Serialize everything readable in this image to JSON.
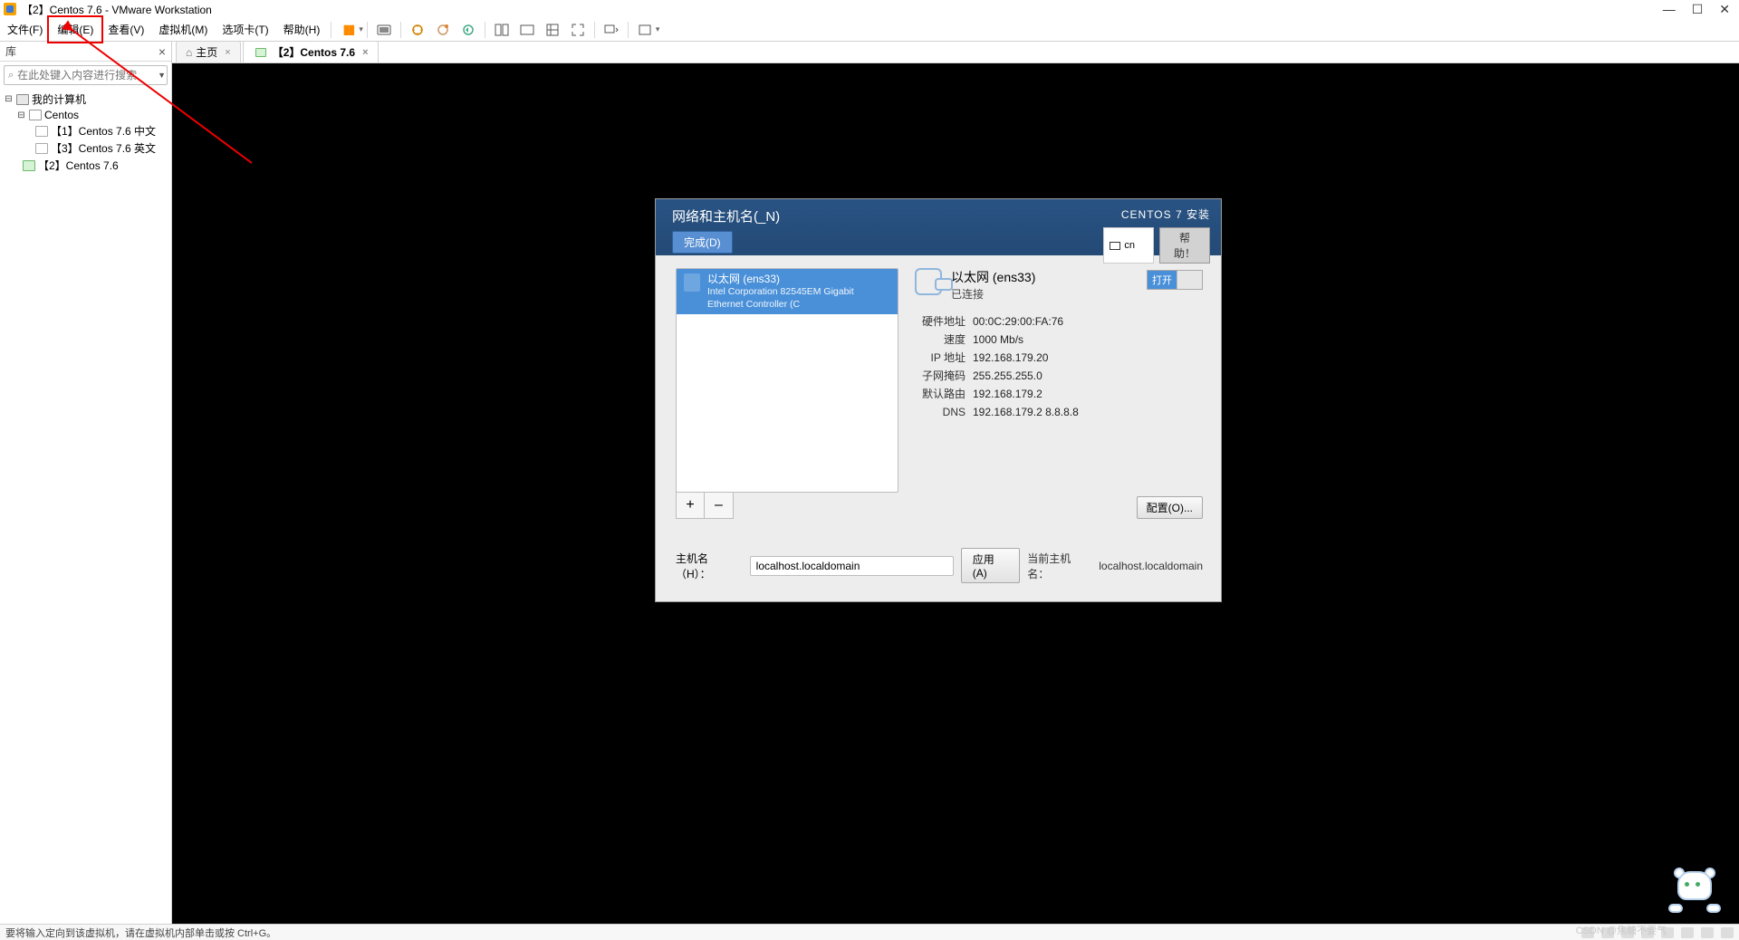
{
  "window": {
    "title": "【2】Centos 7.6 - VMware Workstation"
  },
  "menu": {
    "file": "文件(F)",
    "edit": "编辑(E)",
    "view": "查看(V)",
    "vm": "虚拟机(M)",
    "tabs": "选项卡(T)",
    "help": "帮助(H)"
  },
  "library": {
    "title": "库",
    "search_placeholder": "在此处键入内容进行搜索",
    "root": "我的计算机",
    "folder": "Centos",
    "vm1": "【1】Centos 7.6 中文",
    "vm3": "【3】Centos 7.6 英文",
    "vm2": "【2】Centos 7.6"
  },
  "tabs": {
    "home": "主页",
    "active": "【2】Centos 7.6"
  },
  "centos": {
    "title": "网络和主机名(_N)",
    "done": "完成(D)",
    "install": "CENTOS 7 安装",
    "lang": "cn",
    "help": "帮助！",
    "nic_name": "以太网 (ens33)",
    "nic_sub": "Intel Corporation 82545EM Gigabit Ethernet Controller (C",
    "status": "已连接",
    "toggle_on": "打开",
    "hw_label": "硬件地址",
    "hw": "00:0C:29:00:FA:76",
    "speed_label": "速度",
    "speed": "1000 Mb/s",
    "ip_label": "IP 地址",
    "ip": "192.168.179.20",
    "mask_label": "子网掩码",
    "mask": "255.255.255.0",
    "gw_label": "默认路由",
    "gw": "192.168.179.2",
    "dns_label": "DNS",
    "dns": "192.168.179.2 8.8.8.8",
    "configure": "配置(O)...",
    "host_label": "主机名（H）：",
    "host_value": "localhost.localdomain",
    "apply": "应用(A)",
    "cur_label": "当前主机名：",
    "cur_value": "localhost.localdomain",
    "plus": "+",
    "minus": "–"
  },
  "status": {
    "hint": "要将输入定向到该虚拟机，请在虚拟机内部单击或按 Ctrl+G。"
  },
  "watermark": "CSDN @焦糖不要气"
}
